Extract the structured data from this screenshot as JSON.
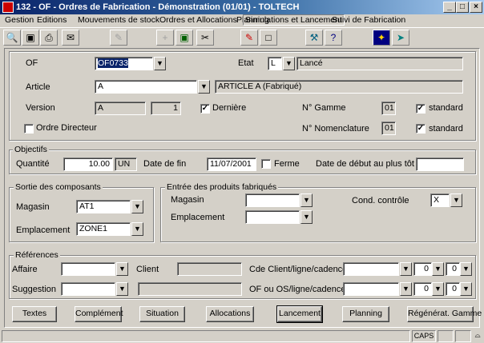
{
  "window": {
    "title": "132 - OF - Ordres de Fabrication - Démonstration (01/01) - TOLTECH",
    "minimize": "_",
    "maximize": "□",
    "close": "×"
  },
  "menu": [
    "Gestion",
    "Editions",
    "Mouvements de stock",
    "Ordres et Allocations",
    "Planning",
    "Simulations et Lancement",
    "Suivi de Fabrication"
  ],
  "toolbar_icons": [
    "search-icon",
    "camera-icon",
    "print-icon",
    "mail-icon",
    "edit-disabled-icon",
    "add-disabled-icon",
    "save-icon",
    "cut-icon",
    "eraser-icon",
    "new-page-icon",
    "tools-icon",
    "help-icon",
    "magic-wand-icon",
    "exit-icon"
  ],
  "header": {
    "of_label": "OF",
    "of_value": "OF0733",
    "etat_label": "Etat",
    "etat_code": "L",
    "etat_text": "Lancé",
    "article_label": "Article",
    "article_value": "A",
    "article_desc": "ARTICLE A (Fabriqué)",
    "version_label": "Version",
    "version_value": "A",
    "version_num": "1",
    "derniere_label": "Dernière",
    "gamme_label": "N° Gamme",
    "gamme_value": "01",
    "standard_label": "standard",
    "ordre_dir_label": "Ordre Directeur",
    "nomenclature_label": "N° Nomenclature",
    "nomenclature_value": "01",
    "standard2_label": "standard"
  },
  "objectifs": {
    "legend": "Objectifs",
    "quantite_label": "Quantité",
    "quantite_value": "10.00",
    "unit": "UN",
    "date_fin_label": "Date de fin",
    "date_fin_value": "11/07/2001",
    "ferme_label": "Ferme",
    "date_debut_label": "Date de début au plus tôt",
    "date_debut_value": ""
  },
  "sortie": {
    "legend": "Sortie des composants",
    "magasin_label": "Magasin",
    "magasin_value": "AT1",
    "emplacement_label": "Emplacement",
    "emplacement_value": "ZONE1"
  },
  "entree": {
    "legend": "Entrée des produits fabriqués",
    "magasin_label": "Magasin",
    "magasin_value": "",
    "emplacement_label": "Emplacement",
    "emplacement_value": "",
    "cond_label": "Cond. contrôle",
    "cond_value": "X"
  },
  "references": {
    "legend": "Références",
    "affaire_label": "Affaire",
    "client_label": "Client",
    "cde_label": "Cde Client/ligne/cadence",
    "suggestion_label": "Suggestion",
    "of_os_label": "OF ou OS/ligne/cadence",
    "zero": "0"
  },
  "buttons": [
    "Textes",
    "Complément",
    "Situation",
    "Allocations",
    "Lancement",
    "Planning",
    "Régénérat. Gamme"
  ],
  "status": {
    "caps": "CAPS"
  }
}
